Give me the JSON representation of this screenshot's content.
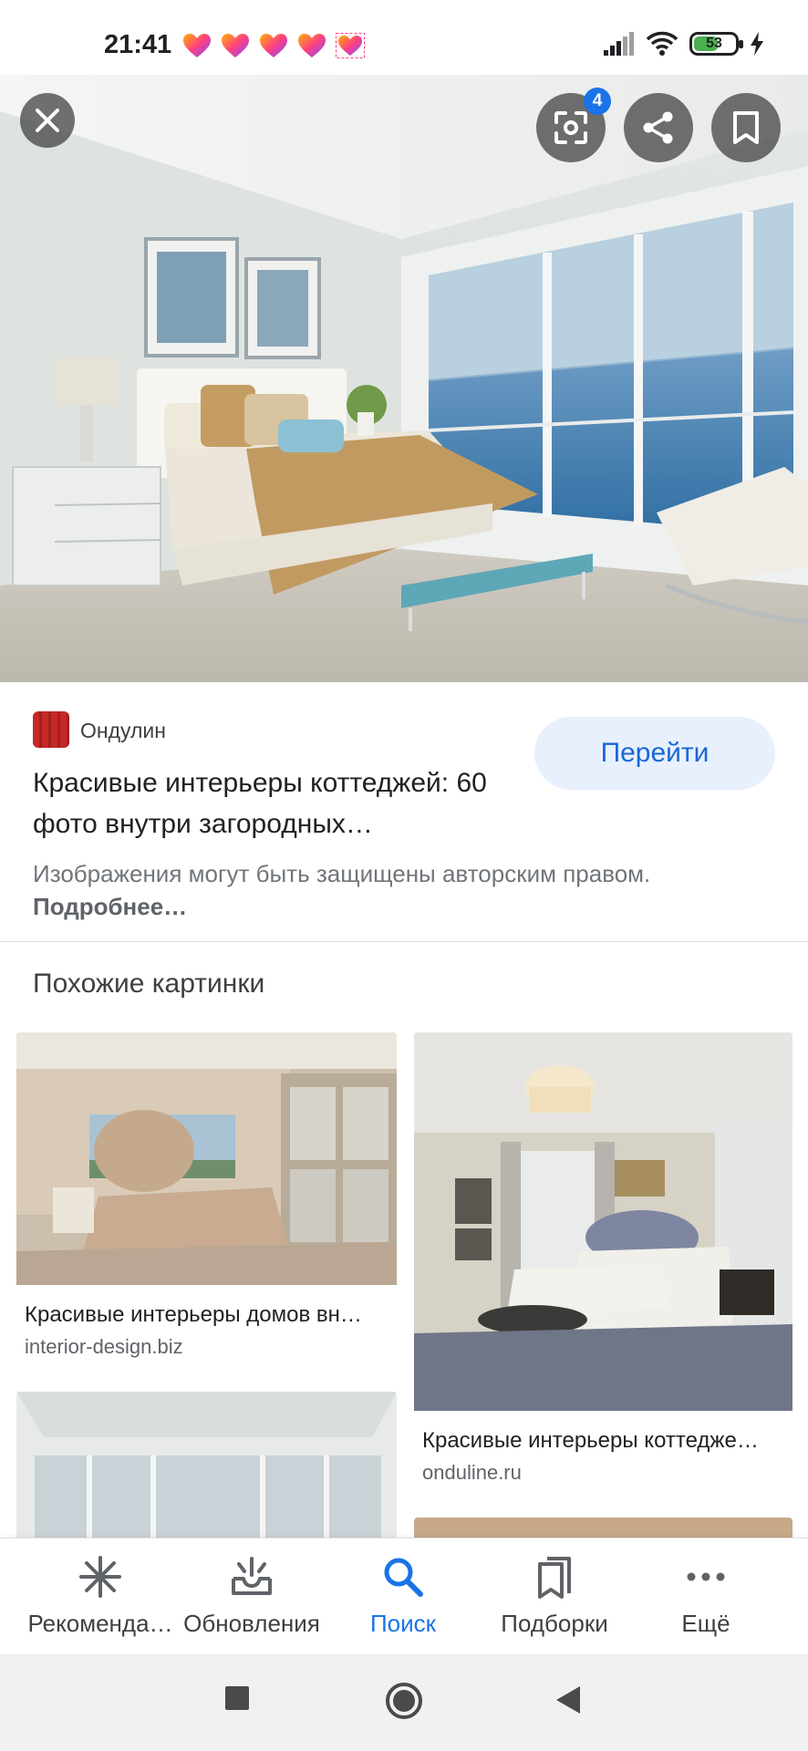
{
  "status_bar": {
    "time": "21:41",
    "battery_level": "53",
    "notification_icons": [
      "heart-app-icon",
      "heart-app-icon",
      "heart-app-icon",
      "heart-app-icon",
      "heart-app-icon"
    ]
  },
  "viewer": {
    "lens_badge": "4"
  },
  "result": {
    "source_name": "Ондулин",
    "title": "Красивые интерьеры коттеджей: 60 фото внутри загородных…",
    "go_button": "Перейти",
    "copyright_text": "Изображения могут быть защищены авторским правом.",
    "more_link": "Подробнее…"
  },
  "similar": {
    "heading": "Похожие картинки",
    "items": [
      {
        "title": "Красивые интерьеры домов вн…",
        "domain": "interior-design.biz"
      },
      {
        "title": "Красивые интерьеры коттедже…",
        "domain": "onduline.ru"
      }
    ]
  },
  "bottom_nav": {
    "items": [
      {
        "label": "Рекоменда…",
        "icon": "asterisk-icon"
      },
      {
        "label": "Обновления",
        "icon": "inbox-updates-icon"
      },
      {
        "label": "Поиск",
        "icon": "search-icon"
      },
      {
        "label": "Подборки",
        "icon": "collections-icon"
      },
      {
        "label": "Ещё",
        "icon": "more-dots-icon"
      }
    ],
    "active_index": 2
  },
  "colors": {
    "accent": "#1a73e8",
    "button_bg": "#e8f0fe"
  }
}
